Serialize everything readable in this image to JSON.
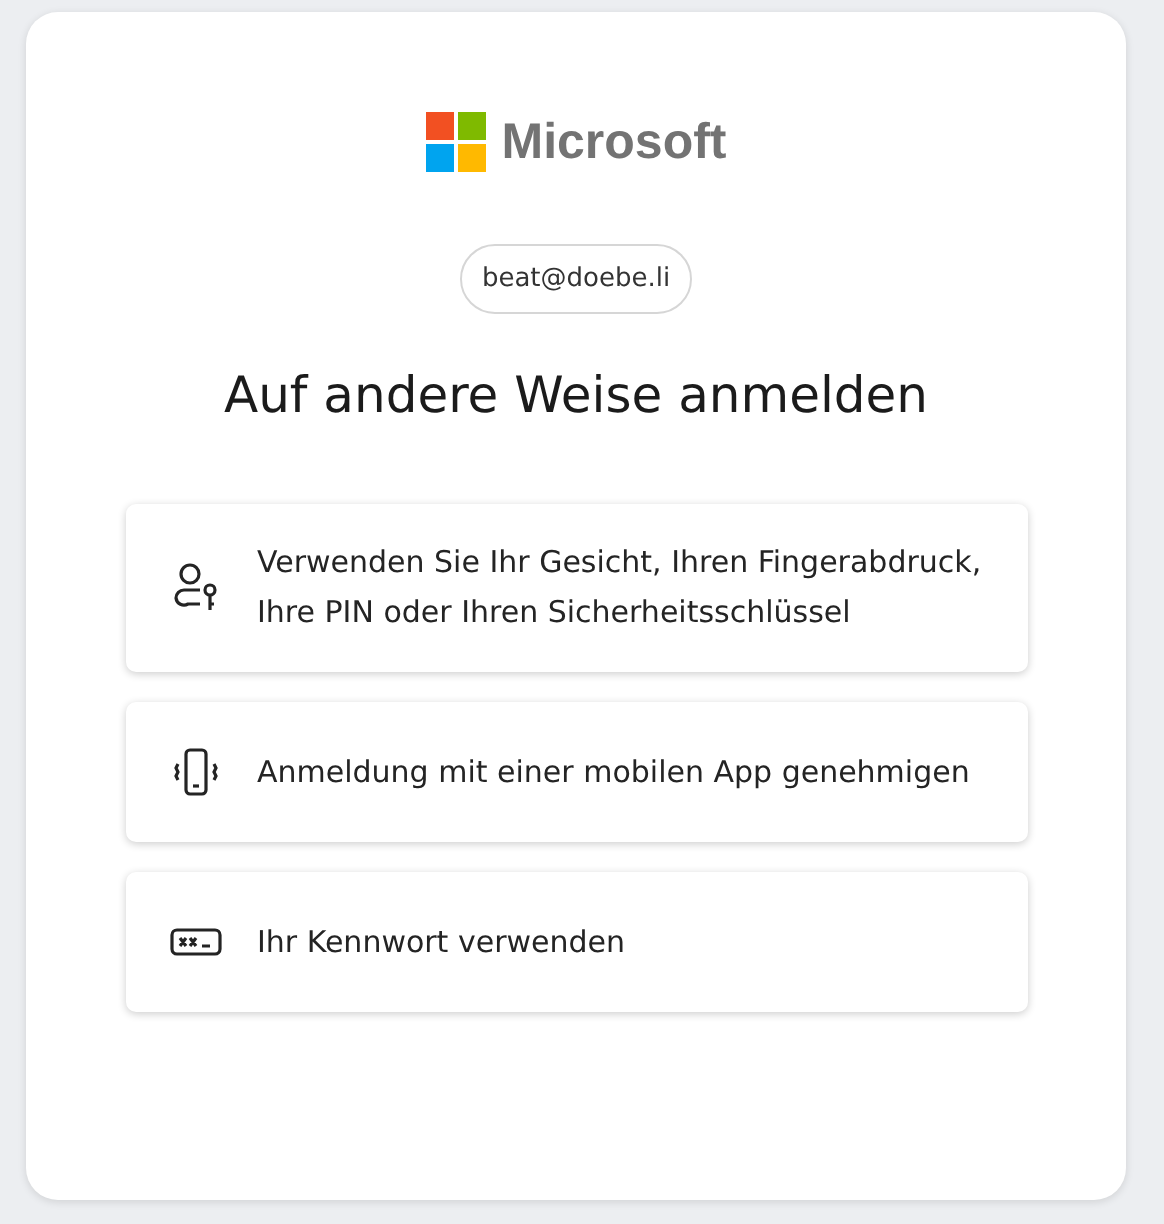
{
  "brand": {
    "name": "Microsoft"
  },
  "account": {
    "email": "beat@doebe.li"
  },
  "title": "Auf andere Weise anmelden",
  "options": [
    {
      "kind": "passkey",
      "label": "Verwenden Sie Ihr Gesicht, Ihren Fingerabdruck, Ihre PIN oder Ihren Sicherheitsschlüssel"
    },
    {
      "kind": "phone",
      "label": "Anmeldung mit einer mobilen App genehmigen"
    },
    {
      "kind": "password",
      "label": "Ihr Kennwort verwenden"
    }
  ]
}
